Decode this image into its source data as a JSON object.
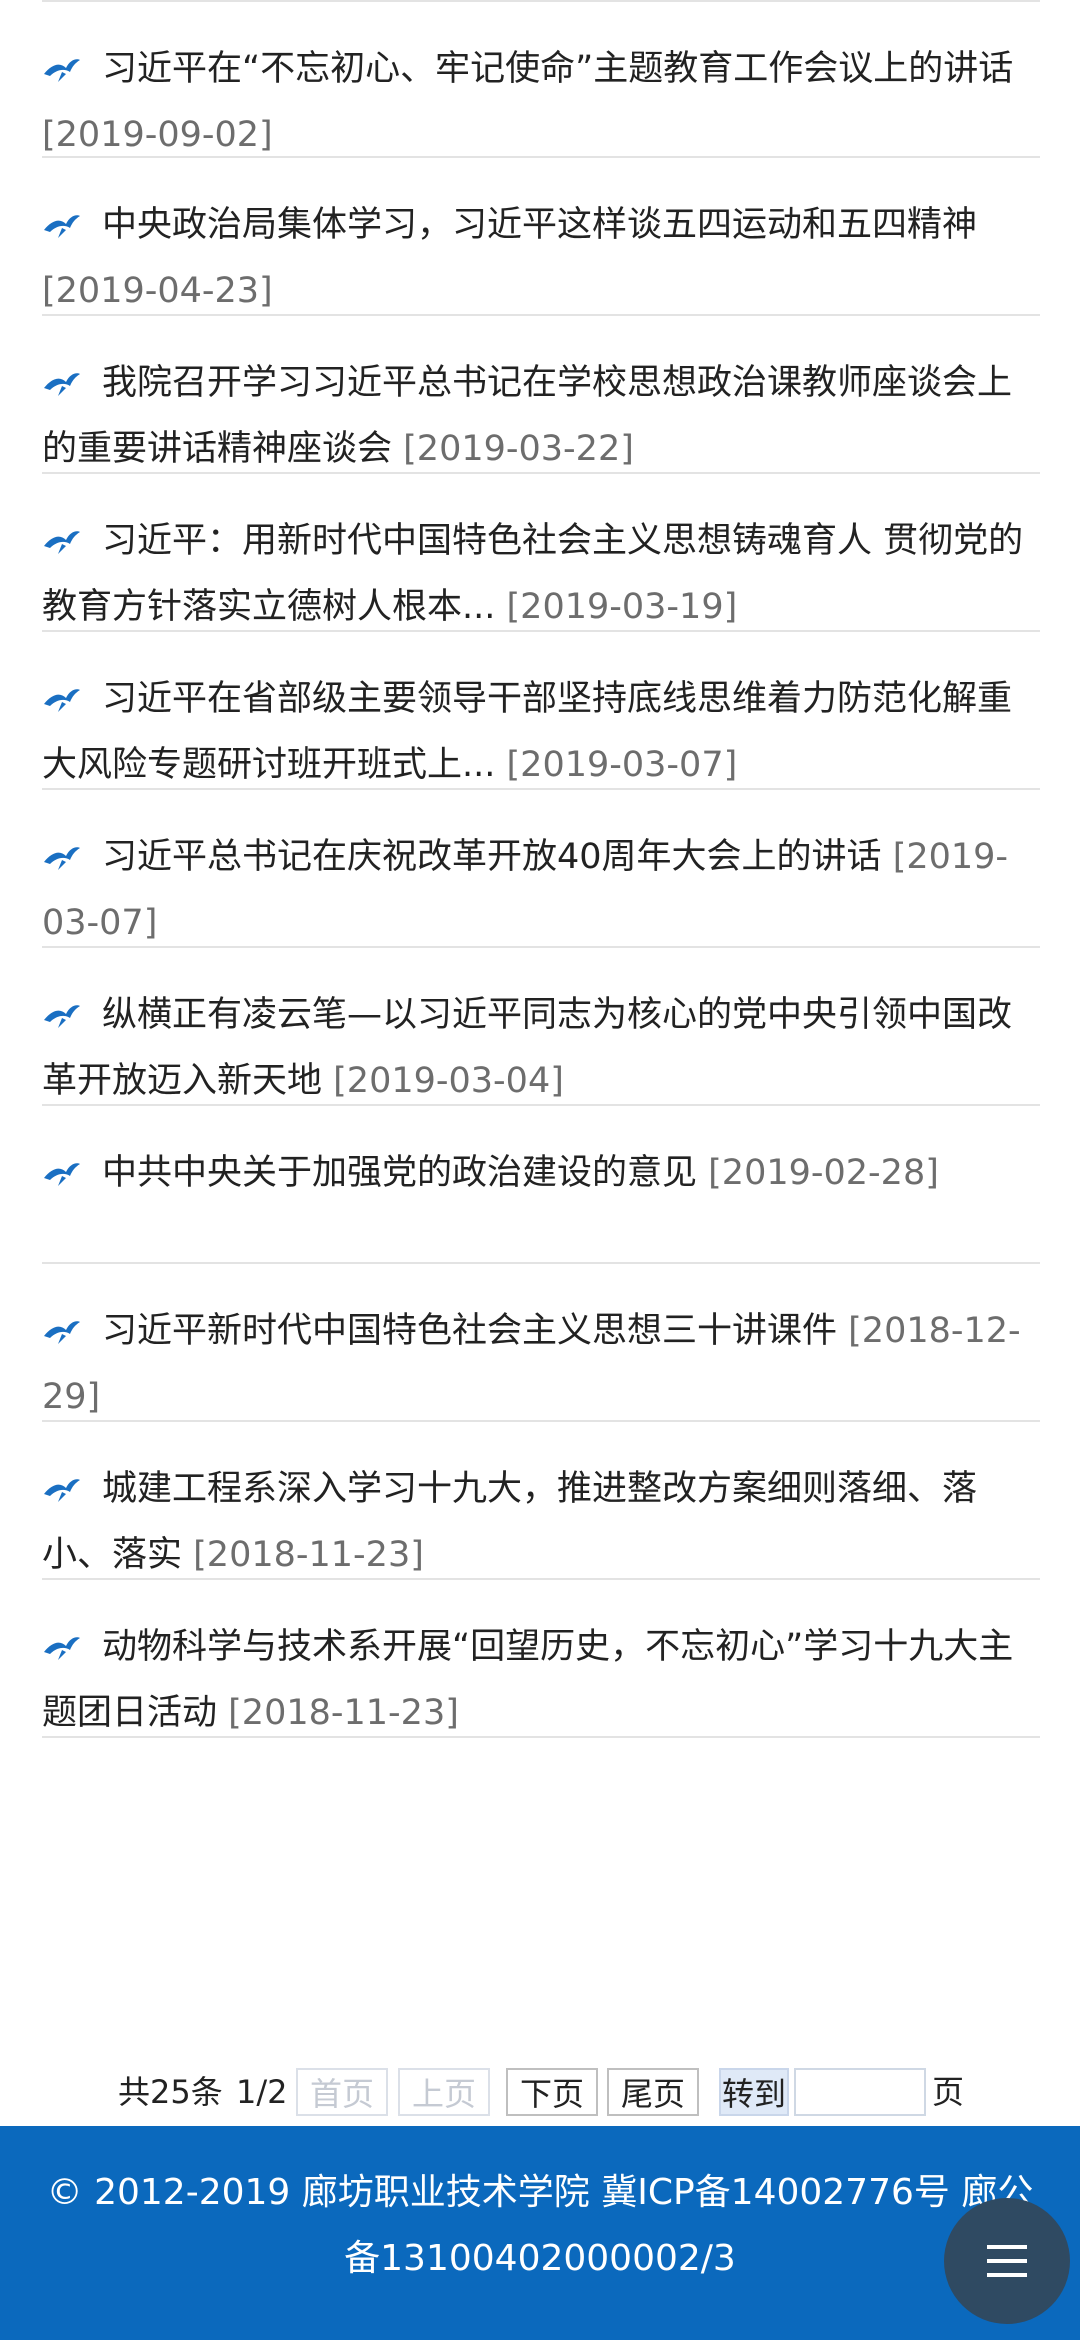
{
  "articles": [
    {
      "title": "习近平在“不忘初心、牢记使命”主题教育工作会议上的讲话",
      "date": "[2019-09-02]"
    },
    {
      "title": "中央政治局集体学习，习近平这样谈五四运动和五四精神",
      "date": "[2019-04-23]"
    },
    {
      "title": "我院召开学习习近平总书记在学校思想政治课教师座谈会上的重要讲话精神座谈会",
      "date": "[2019-03-22]"
    },
    {
      "title": "习近平：用新时代中国特色社会主义思想铸魂育人 贯彻党的教育方针落实立德树人根本...",
      "date": "[2019-03-19]"
    },
    {
      "title": "习近平在省部级主要领导干部坚持底线思维着力防范化解重大风险专题研讨班开班式上...",
      "date": "[2019-03-07]"
    },
    {
      "title": "习近平总书记在庆祝改革开放40周年大会上的讲话",
      "date": "[2019-03-07]"
    },
    {
      "title": "纵横正有凌云笔—以习近平同志为核心的党中央引领中国改革开放迈入新天地",
      "date": "[2019-03-04]"
    },
    {
      "title": "中共中央关于加强党的政治建设的意见",
      "date": "[2019-02-28]"
    },
    {
      "title": "习近平新时代中国特色社会主义思想三十讲课件",
      "date": "[2018-12-29]"
    },
    {
      "title": "城建工程系深入学习十九大，推进整改方案细则落细、落小、落实",
      "date": "[2018-11-23]"
    },
    {
      "title": "动物科学与技术系开展“回望历史，不忘初心”学习十九大主题团日活动",
      "date": "[2018-11-23]"
    }
  ],
  "pager": {
    "total": "共25条",
    "page": "1/2",
    "first": "首页",
    "prev": "上页",
    "next": "下页",
    "last": "尾页",
    "goto": "转到",
    "page_input": "",
    "page_suffix": "页"
  },
  "footer": {
    "text": "© 2012-2019 廊坊职业技术学院 冀ICP备14002776号 廊公备13100402000002/3"
  },
  "colors": {
    "accent": "#0b69bd",
    "bird_icon": "#1a6fc2",
    "date": "#6d6d6d",
    "fab": "#2f4a62"
  },
  "icons": {
    "bullet": "bird-icon",
    "fab": "menu-icon"
  }
}
